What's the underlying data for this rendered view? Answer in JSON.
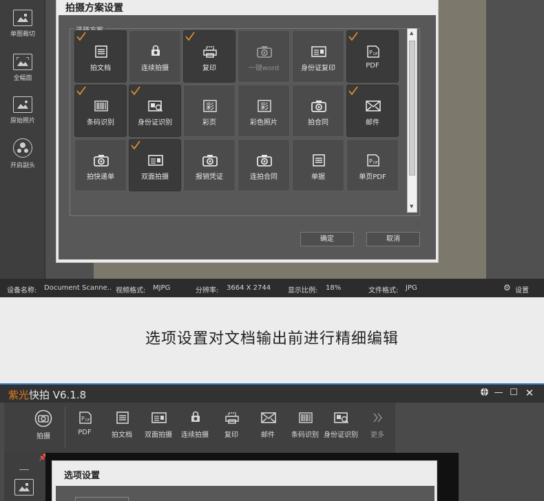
{
  "top_window": {
    "left_tools": [
      {
        "label": "单图裁切",
        "icon": "crop-image-icon"
      },
      {
        "label": "全幅面",
        "icon": "full-frame-icon"
      },
      {
        "label": "原始照片",
        "icon": "original-photo-icon"
      },
      {
        "label": "开启副头",
        "icon": "secondary-camera-icon"
      }
    ],
    "dialog": {
      "title": "拍摄方案设置",
      "group_label": "选择方案",
      "schemes": [
        {
          "label": "拍文档",
          "icon": "document-icon",
          "checked": true,
          "enabled": true
        },
        {
          "label": "连续拍摄",
          "icon": "continuous-shoot-icon",
          "checked": false,
          "enabled": true
        },
        {
          "label": "复印",
          "icon": "copy-icon",
          "checked": true,
          "enabled": true
        },
        {
          "label": "一键word",
          "icon": "camera-icon",
          "checked": false,
          "enabled": false
        },
        {
          "label": "身份证复印",
          "icon": "id-card-icon",
          "checked": false,
          "enabled": true
        },
        {
          "label": "PDF",
          "icon": "pdf-icon",
          "checked": true,
          "enabled": true
        },
        {
          "label": "条码识别",
          "icon": "barcode-icon",
          "checked": true,
          "enabled": true
        },
        {
          "label": "身份证识别",
          "icon": "id-scan-icon",
          "checked": true,
          "enabled": true
        },
        {
          "label": "彩页",
          "icon": "color-page-icon",
          "checked": false,
          "enabled": true
        },
        {
          "label": "彩色照片",
          "icon": "color-photo-icon",
          "checked": false,
          "enabled": true
        },
        {
          "label": "拍合同",
          "icon": "camera-icon",
          "checked": false,
          "enabled": true
        },
        {
          "label": "邮件",
          "icon": "mail-icon",
          "checked": true,
          "enabled": true
        },
        {
          "label": "拍快递单",
          "icon": "camera-icon",
          "checked": false,
          "enabled": true
        },
        {
          "label": "双面拍摄",
          "icon": "id-card-icon",
          "checked": true,
          "enabled": true
        },
        {
          "label": "报销凭证",
          "icon": "camera-icon",
          "checked": false,
          "enabled": true
        },
        {
          "label": "连拍合同",
          "icon": "camera-icon",
          "checked": false,
          "enabled": true
        },
        {
          "label": "单据",
          "icon": "document-icon",
          "checked": false,
          "enabled": true
        },
        {
          "label": "单页PDF",
          "icon": "pdf-icon",
          "checked": false,
          "enabled": true
        }
      ],
      "ok_label": "确定",
      "cancel_label": "取消"
    },
    "status": {
      "device_label": "设备名称:",
      "device_value": "Document Scanne..",
      "video_label": "视频格式:",
      "video_value": "MJPG",
      "res_label": "分辨率:",
      "res_value": "3664 X 2744",
      "ratio_label": "显示比例:",
      "ratio_value": "18%",
      "file_label": "文件格式:",
      "file_value": "JPG",
      "settings_label": "设置"
    }
  },
  "caption": "选项设置对文档输出前进行精细编辑",
  "bottom_window": {
    "title_brand": "紫光",
    "title_rest": "快拍 V6.1.8",
    "toolbar": [
      {
        "label": "拍摄",
        "icon": "shoot-icon"
      },
      {
        "label": "PDF",
        "icon": "pdf-icon"
      },
      {
        "label": "拍文档",
        "icon": "document-icon"
      },
      {
        "label": "双面拍摄",
        "icon": "id-card-icon"
      },
      {
        "label": "连续拍摄",
        "icon": "continuous-shoot-icon"
      },
      {
        "label": "复印",
        "icon": "copy-icon"
      },
      {
        "label": "邮件",
        "icon": "mail-icon"
      },
      {
        "label": "条码识别",
        "icon": "barcode-icon"
      },
      {
        "label": "身份证识别",
        "icon": "id-scan-icon"
      },
      {
        "label": "更多",
        "icon": "more-chevron-icon"
      }
    ],
    "dialog_title": "选项设置"
  },
  "colors": {
    "accent_check": "#e8952c",
    "brand_orange": "#e07a1c",
    "titlebar_blue": "#2f78c4"
  }
}
